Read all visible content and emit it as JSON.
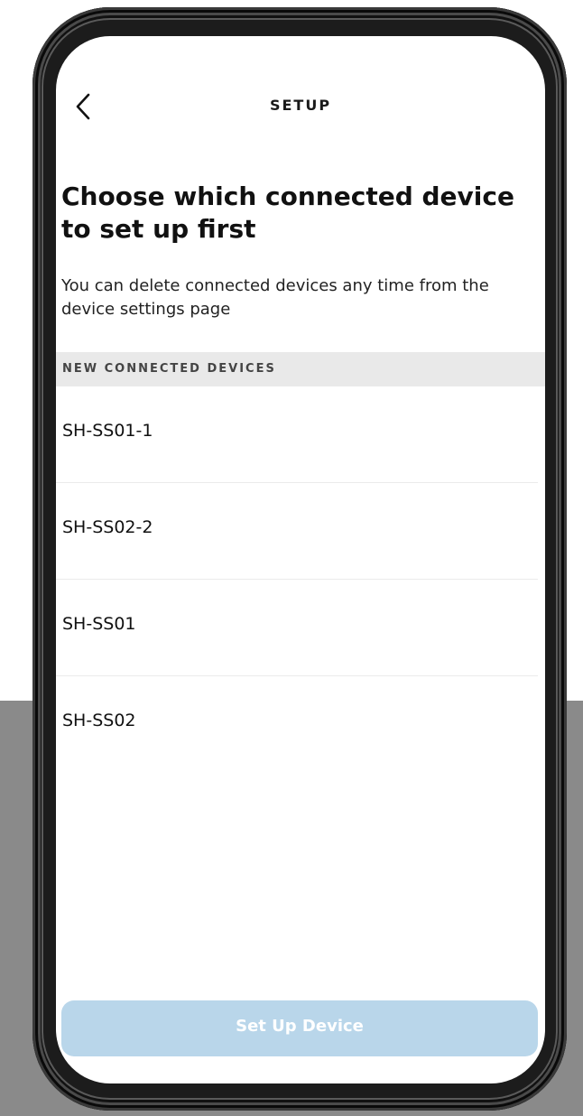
{
  "header": {
    "title": "SETUP",
    "back_icon": "chevron-left-icon"
  },
  "main": {
    "headline": "Choose which connected device to set up first",
    "subtitle": "You can delete connected devices any time from the device settings page",
    "section_label": "NEW CONNECTED DEVICES",
    "devices": [
      {
        "label": "SH-SS01-1"
      },
      {
        "label": "SH-SS02-2"
      },
      {
        "label": "SH-SS01"
      },
      {
        "label": "SH-SS02"
      }
    ]
  },
  "footer": {
    "setup_button_label": "Set Up Device",
    "button_state": "disabled"
  },
  "colors": {
    "primary_button_disabled": "#b9d6ea",
    "section_background": "#e9e9e9",
    "text": "#111111"
  }
}
